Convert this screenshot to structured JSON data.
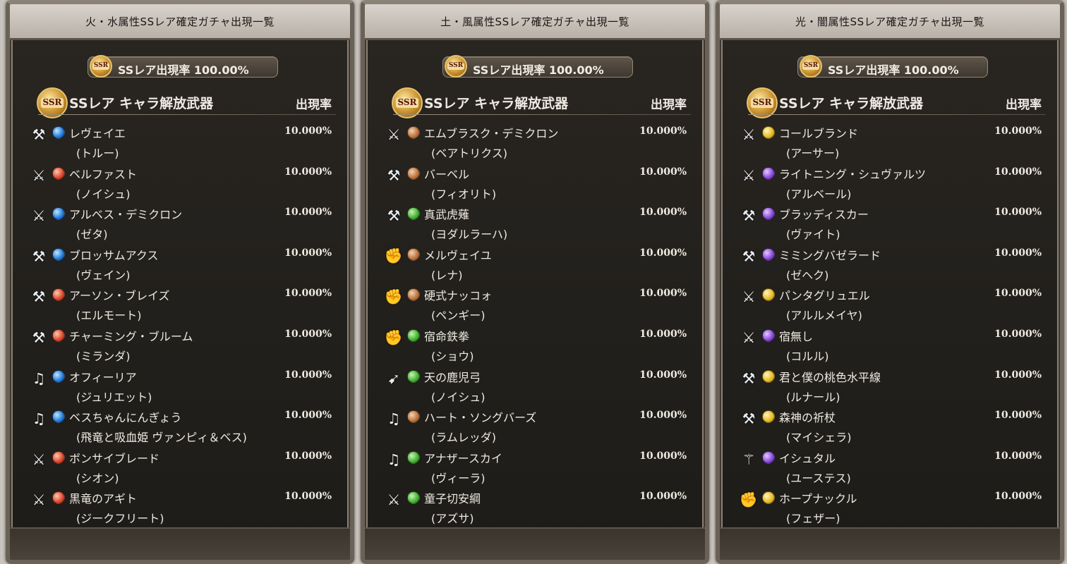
{
  "panels": [
    {
      "title": "火・水属性SSレア確定ガチャ出現一覧",
      "rate_badge": "SSレア出現率 100.00%",
      "section_label": "SSレア キャラ解放武器",
      "rate_header": "出現率",
      "items": [
        {
          "weapon_icon": "axe-icon",
          "element": "water",
          "name": "レヴェイエ",
          "character": "(トルー)",
          "rate": "10.000%"
        },
        {
          "weapon_icon": "spear-icon",
          "element": "fire",
          "name": "ベルファスト",
          "character": "(ノイシュ)",
          "rate": "10.000%"
        },
        {
          "weapon_icon": "spear-icon",
          "element": "water",
          "name": "アルベス・デミクロン",
          "character": "(ゼタ)",
          "rate": "10.000%"
        },
        {
          "weapon_icon": "axe-icon",
          "element": "water",
          "name": "ブロッサムアクス",
          "character": "(ヴェイン)",
          "rate": "10.000%"
        },
        {
          "weapon_icon": "axe-icon",
          "element": "fire",
          "name": "アーソン・ブレイズ",
          "character": "(エルモート)",
          "rate": "10.000%"
        },
        {
          "weapon_icon": "axe-icon",
          "element": "fire",
          "name": "チャーミング・ブルーム",
          "character": "(ミランダ)",
          "rate": "10.000%"
        },
        {
          "weapon_icon": "harp-icon",
          "element": "water",
          "name": "オフィーリア",
          "character": "(ジュリエット)",
          "rate": "10.000%"
        },
        {
          "weapon_icon": "harp-icon",
          "element": "water",
          "name": "ベスちゃんにんぎょう",
          "character": "(飛竜と吸血姫 ヴァンピィ＆ベス)",
          "rate": "10.000%"
        },
        {
          "weapon_icon": "sword-icon",
          "element": "fire",
          "name": "ボンサイブレード",
          "character": "(シオン)",
          "rate": "10.000%"
        },
        {
          "weapon_icon": "sword-icon",
          "element": "fire",
          "name": "黒竜のアギト",
          "character": "(ジークフリート)",
          "rate": "10.000%"
        }
      ]
    },
    {
      "title": "土・風属性SSレア確定ガチャ出現一覧",
      "rate_badge": "SSレア出現率 100.00%",
      "section_label": "SSレア キャラ解放武器",
      "rate_header": "出現率",
      "items": [
        {
          "weapon_icon": "spear-icon",
          "element": "earth",
          "name": "エムブラスク・デミクロン",
          "character": "(ベアトリクス)",
          "rate": "10.000%"
        },
        {
          "weapon_icon": "axe-icon",
          "element": "earth",
          "name": "バーベル",
          "character": "(フィオリト)",
          "rate": "10.000%"
        },
        {
          "weapon_icon": "axe-icon",
          "element": "wind",
          "name": "真武虎薙",
          "character": "(ヨダルラーハ)",
          "rate": "10.000%"
        },
        {
          "weapon_icon": "fist-icon",
          "element": "earth",
          "name": "メルヴェイユ",
          "character": "(レナ)",
          "rate": "10.000%"
        },
        {
          "weapon_icon": "fist-icon",
          "element": "earth",
          "name": "硬式ナッコォ",
          "character": "(ペンギー)",
          "rate": "10.000%"
        },
        {
          "weapon_icon": "fist-icon",
          "element": "wind",
          "name": "宿命鉄拳",
          "character": "(ショウ)",
          "rate": "10.000%"
        },
        {
          "weapon_icon": "bow-icon",
          "element": "wind",
          "name": "天の鹿児弓",
          "character": "(ノイシュ)",
          "rate": "10.000%"
        },
        {
          "weapon_icon": "harp-icon",
          "element": "earth",
          "name": "ハート・ソングバーズ",
          "character": "(ラムレッダ)",
          "rate": "10.000%"
        },
        {
          "weapon_icon": "harp-icon",
          "element": "wind",
          "name": "アナザースカイ",
          "character": "(ヴィーラ)",
          "rate": "10.000%"
        },
        {
          "weapon_icon": "sword-icon",
          "element": "wind",
          "name": "童子切安綱",
          "character": "(アズサ)",
          "rate": "10.000%"
        }
      ]
    },
    {
      "title": "光・闇属性SSレア確定ガチャ出現一覧",
      "rate_badge": "SSレア出現率 100.00%",
      "section_label": "SSレア キャラ解放武器",
      "rate_header": "出現率",
      "items": [
        {
          "weapon_icon": "spear-icon",
          "element": "light",
          "name": "コールブランド",
          "character": "(アーサー)",
          "rate": "10.000%"
        },
        {
          "weapon_icon": "spear-icon",
          "element": "dark",
          "name": "ライトニング・シュヴァルツ",
          "character": "(アルベール)",
          "rate": "10.000%"
        },
        {
          "weapon_icon": "axe-icon",
          "element": "dark",
          "name": "ブラッディスカー",
          "character": "(ヴァイト)",
          "rate": "10.000%"
        },
        {
          "weapon_icon": "axe-icon",
          "element": "dark",
          "name": "ミミングバゼラード",
          "character": "(ゼヘク)",
          "rate": "10.000%"
        },
        {
          "weapon_icon": "spear-icon",
          "element": "light",
          "name": "パンタグリュエル",
          "character": "(アルルメイヤ)",
          "rate": "10.000%"
        },
        {
          "weapon_icon": "spear-icon",
          "element": "dark",
          "name": "宿無し",
          "character": "(コルル)",
          "rate": "10.000%"
        },
        {
          "weapon_icon": "axe-icon",
          "element": "light",
          "name": "君と僕の桃色水平線",
          "character": "(ルナール)",
          "rate": "10.000%"
        },
        {
          "weapon_icon": "axe-icon",
          "element": "light",
          "name": "森神の祈杖",
          "character": "(マイシェラ)",
          "rate": "10.000%"
        },
        {
          "weapon_icon": "staff-icon",
          "element": "dark",
          "name": "イシュタル",
          "character": "(ユーステス)",
          "rate": "10.000%"
        },
        {
          "weapon_icon": "fist-icon",
          "element": "light",
          "name": "ホープナックル",
          "character": "(フェザー)",
          "rate": "10.000%"
        }
      ]
    }
  ]
}
